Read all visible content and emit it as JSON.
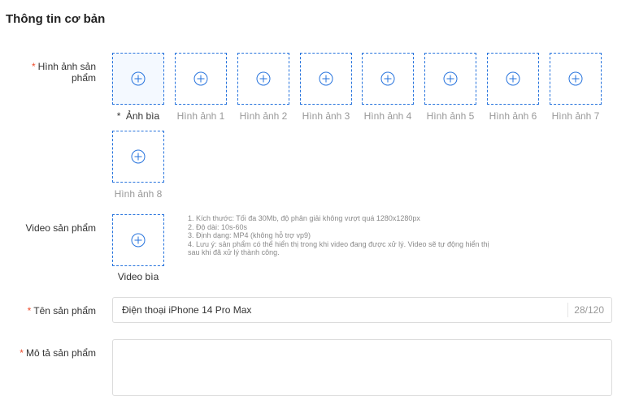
{
  "section": {
    "title": "Thông tin cơ bản"
  },
  "fields": {
    "images_label": "Hình ảnh sản phẩm",
    "video_label": "Video sản phẩm",
    "name_label": "Tên sản phẩm",
    "description_label": "Mô tả sản phẩm",
    "required_mark": "*"
  },
  "images": {
    "cover_label": "Ảnh bìa",
    "slots": [
      "Hình ảnh 1",
      "Hình ảnh 2",
      "Hình ảnh 3",
      "Hình ảnh 4",
      "Hình ảnh 5",
      "Hình ảnh 6",
      "Hình ảnh 7",
      "Hình ảnh 8"
    ],
    "icon": "plus-circle-icon"
  },
  "video": {
    "cover_label": "Video bìa",
    "notes": [
      "1. Kích thước: Tối đa 30Mb, độ phân giải không vượt quá 1280x1280px",
      "2. Độ dài: 10s-60s",
      "3. Định dạng: MP4 (không hỗ trợ vp9)",
      "4. Lưu ý: sản phẩm có thể hiển thị trong khi video đang được xử lý. Video sẽ tự động hiển thị",
      "sau khi đã xử lý thành công."
    ]
  },
  "product_name": {
    "value": "Điện thoại iPhone 14 Pro Max",
    "counter": "28/120"
  },
  "description": {
    "value": ""
  },
  "colors": {
    "accent": "#2673dd",
    "required": "#ee4d2d"
  }
}
